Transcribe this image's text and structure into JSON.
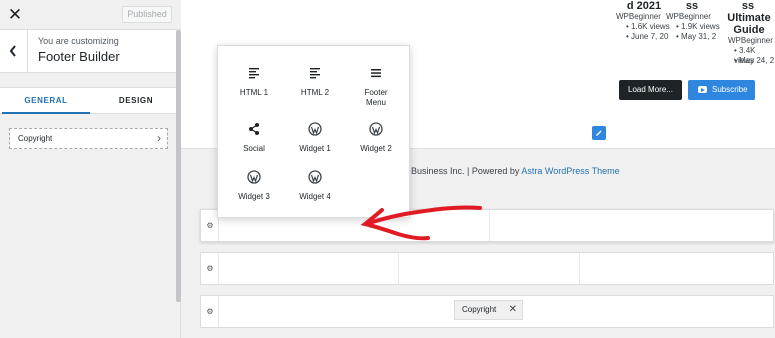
{
  "sidebar": {
    "published_label": "Published",
    "customizing_label": "You are customizing",
    "panel_title": "Footer Builder",
    "tabs": [
      {
        "label": "GENERAL",
        "active": true
      },
      {
        "label": "DESIGN",
        "active": false
      }
    ],
    "item_label": "Copyright"
  },
  "posts": [
    {
      "title": "d 2021",
      "author": "WPBeginner",
      "views": "• 1.6K views",
      "date": "• June 7, 20"
    },
    {
      "title": "ss",
      "author": "WPBeginner",
      "views": "• 1.9K views",
      "date": "• May 31, 2"
    },
    {
      "title_lines": [
        "ss",
        "Ultimate",
        "Guide"
      ],
      "author": "WPBeginner",
      "views": "• 3.4K views",
      "date": "• May 24, 2"
    }
  ],
  "actions": {
    "load_more": "Load More...",
    "subscribe": "Subscribe"
  },
  "footer": {
    "credit_text": "Business Inc. | Powered by ",
    "credit_link": "Astra WordPress Theme"
  },
  "builder": {
    "add_symbol": "+",
    "chip_label": "Copyright",
    "chip_remove": "✕"
  },
  "widgets": [
    {
      "label": "HTML 1",
      "icon": "text-align-icon"
    },
    {
      "label": "HTML 2",
      "icon": "text-align-icon"
    },
    {
      "label_lines": [
        "Footer",
        "Menu"
      ],
      "icon": "menu-icon"
    },
    {
      "label": "Social",
      "icon": "share-icon"
    },
    {
      "label": "Widget 1",
      "icon": "wordpress-icon"
    },
    {
      "label": "Widget 2",
      "icon": "wordpress-icon"
    },
    {
      "label": "Widget 3",
      "icon": "wordpress-icon"
    },
    {
      "label": "Widget 4",
      "icon": "wordpress-icon"
    }
  ],
  "colors": {
    "accent": "#2271b1",
    "subscribe": "#2e86de",
    "arrow": "#e01b24"
  }
}
